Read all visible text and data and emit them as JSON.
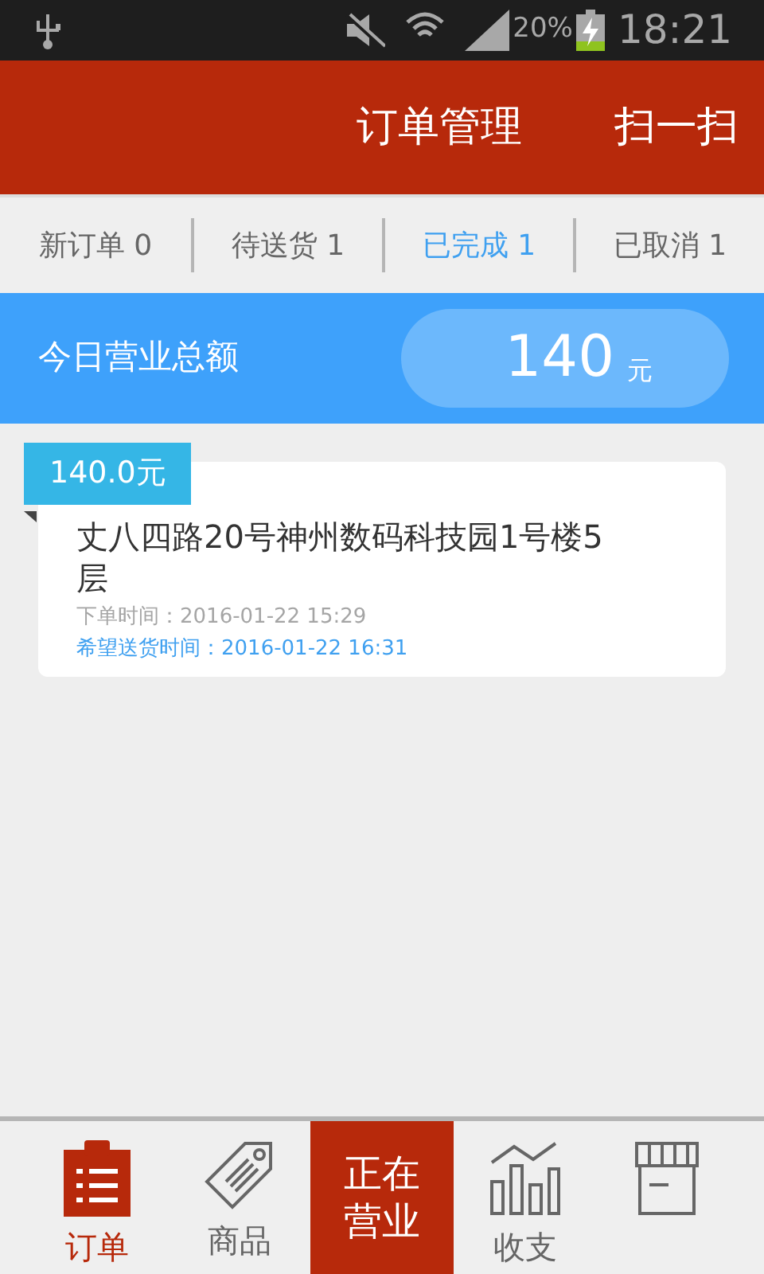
{
  "status_bar": {
    "battery": "20%",
    "time": "18:21"
  },
  "header": {
    "title": "订单管理",
    "action": "扫一扫"
  },
  "tabs": [
    {
      "label": "新订单 0",
      "selected": false
    },
    {
      "label": "待送货 1",
      "selected": false
    },
    {
      "label": "已完成 1",
      "selected": true
    },
    {
      "label": "已取消 1",
      "selected": false
    }
  ],
  "summary": {
    "label": "今日营业总额",
    "amount": "140",
    "unit": "元"
  },
  "orders": [
    {
      "price": "140.0元",
      "address": "丈八四路20号神州数码科技园1号楼5层",
      "order_time": "下单时间：2016-01-22 15:29",
      "delivery_time": "希望送货时间：2016-01-22 16:31"
    }
  ],
  "bottom_nav": [
    {
      "kind": "tab",
      "label": "订单",
      "selected": true
    },
    {
      "kind": "tab",
      "label": "商品",
      "selected": false
    },
    {
      "kind": "status",
      "label": "正在营业"
    },
    {
      "kind": "tab",
      "label": "收支",
      "selected": false
    },
    {
      "kind": "tab",
      "selected": false
    }
  ]
}
